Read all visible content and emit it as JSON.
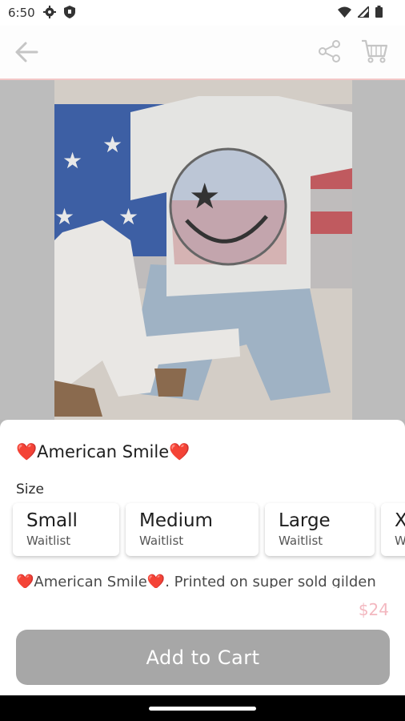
{
  "status_bar": {
    "time": "6:50",
    "gear_icon": "gear-icon",
    "shield_icon": "shield-icon",
    "wifi_icon": "wifi-icon",
    "signal_icon": "signal-icon",
    "battery_icon": "battery-icon"
  },
  "app_bar": {
    "back_icon": "arrow-left-icon",
    "share_icon": "share-icon",
    "cart_icon": "cart-icon"
  },
  "product": {
    "title": "❤️American Smile❤️",
    "size_label": "Size",
    "sizes": [
      {
        "name": "Small",
        "status": "Waitlist"
      },
      {
        "name": "Medium",
        "status": "Waitlist"
      },
      {
        "name": "Large",
        "status": "Waitlist"
      },
      {
        "name": "X",
        "status": "W"
      }
    ],
    "description": "❤️American Smile❤️. Printed on super sold gilden",
    "price": "$24",
    "add_to_cart_label": "Add to Cart"
  },
  "colors": {
    "accent_pink": "#f3b8c0",
    "button_disabled": "#a7a7a7"
  }
}
